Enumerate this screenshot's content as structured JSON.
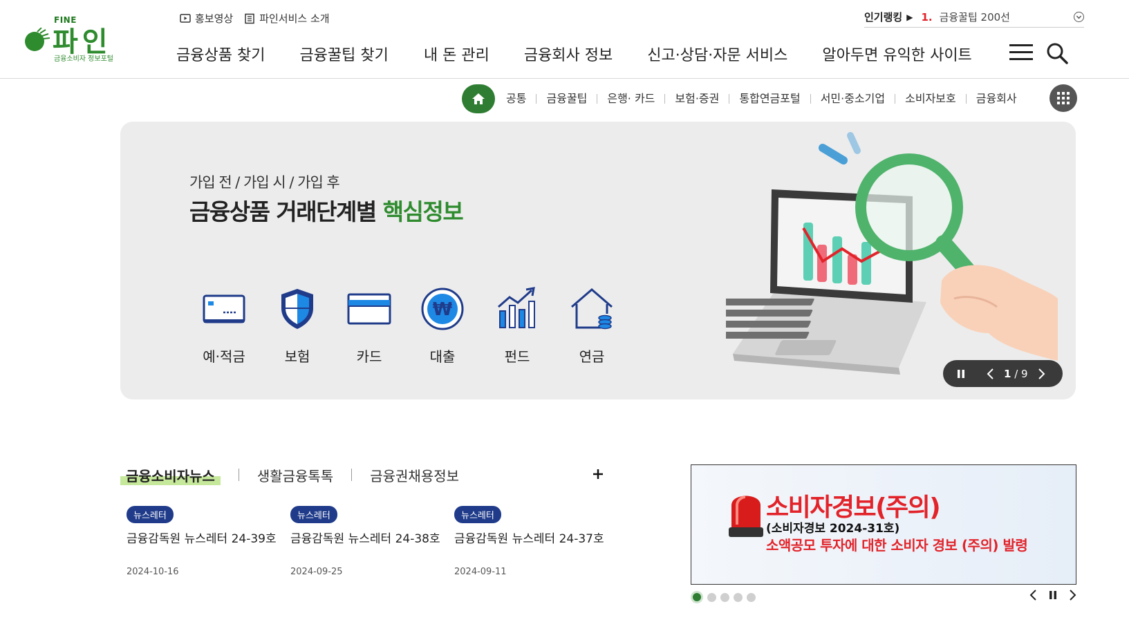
{
  "logo": {
    "fine": "FINE",
    "name": "파인",
    "sub": "금융소비자 정보포털"
  },
  "utility": {
    "video": "홍보영상",
    "intro": "파인서비스 소개"
  },
  "ranking": {
    "label": "인기랭킹",
    "rank": "1.",
    "text": "금융꿀팁 200선"
  },
  "gnb": [
    "금융상품 찾기",
    "금융꿀팁 찾기",
    "내 돈 관리",
    "금융회사 정보",
    "신고·상담·자문 서비스",
    "알아두면 유익한 사이트"
  ],
  "subnav": [
    "공통",
    "금융꿀팁",
    "은행· 카드",
    "보험·증권",
    "통합연금포털",
    "서민·중소기업",
    "소비자보호",
    "금융회사"
  ],
  "hero": {
    "pre": "가입 전 / 가입 시 / 가입 후",
    "title": "금융상품 거래단계별",
    "title_hl": "핵심정보",
    "categories": [
      "예·적금",
      "보험",
      "카드",
      "대출",
      "펀드",
      "연금"
    ],
    "pager_current": "1",
    "pager_sep": " / ",
    "pager_total": "9"
  },
  "news": {
    "tabs": [
      "금융소비자뉴스",
      "생활금융톡톡",
      "금융권채용정보"
    ],
    "items": [
      {
        "badge": "뉴스레터",
        "title": "금융감독원 뉴스레터 24-39호",
        "date": "2024-10-16"
      },
      {
        "badge": "뉴스레터",
        "title": "금융감독원 뉴스레터 24-38호",
        "date": "2024-09-25"
      },
      {
        "badge": "뉴스레터",
        "title": "금융감독원 뉴스레터 24-37호",
        "date": "2024-09-11"
      }
    ]
  },
  "alert": {
    "title": "소비자경보(주의)",
    "sub": "(소비자경보 2024-31호)",
    "desc": "소액공모 투자에 대한 소비자 경보 (주의) 발령",
    "slides": 5,
    "active_slide": 1
  },
  "colors": {
    "brand_green": "#2e7d32",
    "alert_red": "#e2232a",
    "badge_blue": "#1f3b8a",
    "icon_navy": "#1f3b8a"
  }
}
